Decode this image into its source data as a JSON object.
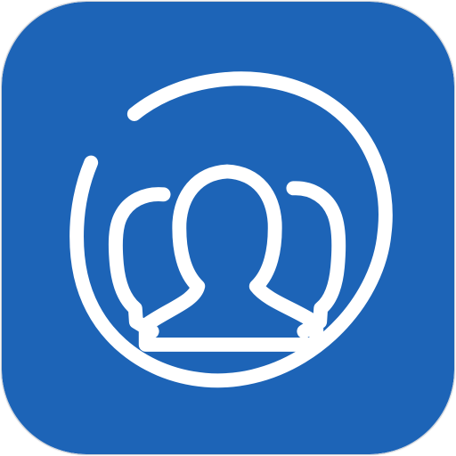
{
  "icon": {
    "name": "contacts-group-icon",
    "background_color": "#1d64b7",
    "stroke_color": "#ffffff",
    "border_color": "#c9ced6"
  }
}
